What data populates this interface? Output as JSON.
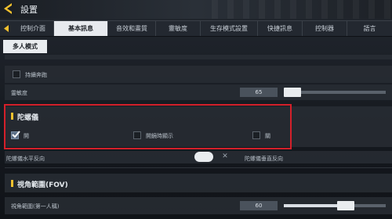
{
  "header": {
    "title": "設置"
  },
  "tabs": [
    {
      "label": "控制介面"
    },
    {
      "label": "基本訊息"
    },
    {
      "label": "音效和畫質"
    },
    {
      "label": "靈敏度"
    },
    {
      "label": "生存模式設置"
    },
    {
      "label": "快捷訊息"
    },
    {
      "label": "控制器"
    },
    {
      "label": "語言"
    }
  ],
  "active_tab": "基本訊息",
  "subtab": {
    "label": "多人模式"
  },
  "settings": {
    "continuous_run": {
      "label": "持續奔跑",
      "checked": false
    },
    "sensitivity": {
      "label": "靈敏度",
      "value": "65",
      "fill_fraction": 0.0
    },
    "gyroscope": {
      "title": "陀螺儀",
      "options": [
        {
          "label": "開",
          "checked": true
        },
        {
          "label": "開鏡時顯示",
          "checked": false
        },
        {
          "label": "關",
          "checked": false
        }
      ]
    },
    "gyro_horizontal_invert": {
      "label": "陀螺儀水平反向",
      "value_on": true
    },
    "gyro_vertical_invert": {
      "label": "陀螺儀垂直反向"
    },
    "fov": {
      "title": "視角範圍(FOV)"
    },
    "fov_first_person": {
      "label": "視角範圍(第一人稱)",
      "value": "60",
      "fill_fraction": 0.55
    }
  },
  "colors": {
    "accent": "#f2c12e",
    "highlight": "#d4202a"
  }
}
